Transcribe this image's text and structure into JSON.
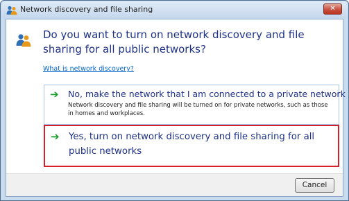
{
  "window": {
    "title": "Network discovery and file sharing",
    "close_label": "✕"
  },
  "dialog": {
    "question": "Do you want to turn on network discovery and file sharing for all public networks?",
    "help_link": "What is network discovery?"
  },
  "options": [
    {
      "title": "No, make the network that I am connected to a private network",
      "description": "Network discovery and file sharing will be turned on for private networks, such as those in homes and workplaces.",
      "icon": "green-arrow-icon"
    },
    {
      "title": "Yes, turn on network discovery and file sharing for all public networks",
      "description": "",
      "icon": "green-arrow-icon",
      "highlighted": true
    }
  ],
  "footer": {
    "cancel_label": "Cancel"
  },
  "colors": {
    "title_text": "#1e3287",
    "link": "#0066cc",
    "arrow": "#1a9c2a",
    "highlight_border": "#d61f2b",
    "close_button": "#c95240"
  }
}
